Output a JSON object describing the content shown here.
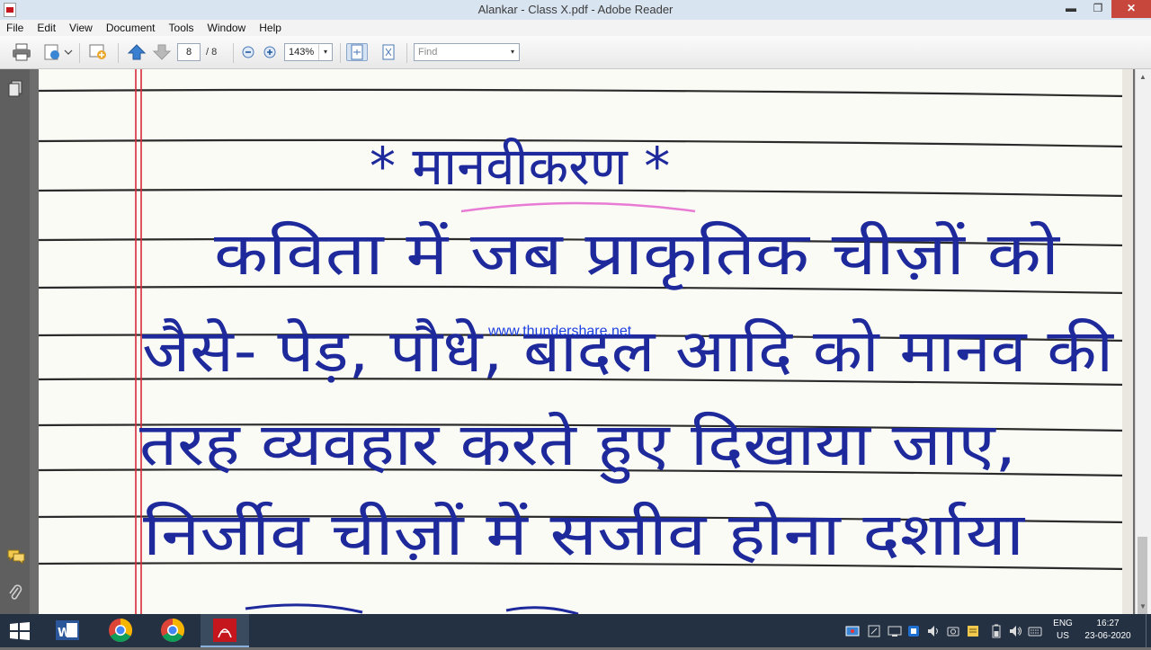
{
  "window": {
    "title": "Alankar - Class X.pdf - Adobe Reader"
  },
  "window_controls": {
    "minimize": "▬",
    "restore": "❐",
    "close": "✕"
  },
  "menubar": {
    "items": [
      "File",
      "Edit",
      "View",
      "Document",
      "Tools",
      "Window",
      "Help"
    ]
  },
  "toolbar": {
    "page_current": "8",
    "page_total": "/ 8",
    "zoom": "143%",
    "find_placeholder": "Find",
    "dropdown_arrow": "▾"
  },
  "document": {
    "watermark": "www.thundershare.net",
    "handwritten_text": [
      "* मानवीकरण *",
      "कविता में जब प्राकृतिक चीज़ों को",
      "जैसे- पेड़, पौधे, बादल आदि को मानव की",
      "तरह व्यवहार करते हुए दिखाया जाए,",
      "निर्जीव चीज़ों में सजीव होना दर्शाया"
    ]
  },
  "scrollbar": {
    "up": "▲",
    "down": "▼"
  },
  "taskbar": {
    "apps": [
      "word",
      "chrome",
      "chrome",
      "adobe-reader"
    ],
    "language": "ENG",
    "region": "US",
    "time": "16:27",
    "date": "23-06-2020"
  },
  "colors": {
    "ink": "#1e2a9c",
    "pink_underline": "#e87bd3",
    "margin_red": "#d62b3a",
    "rule_line": "#2b2b2b",
    "close_button": "#c7473c",
    "taskbar": "#243143"
  }
}
